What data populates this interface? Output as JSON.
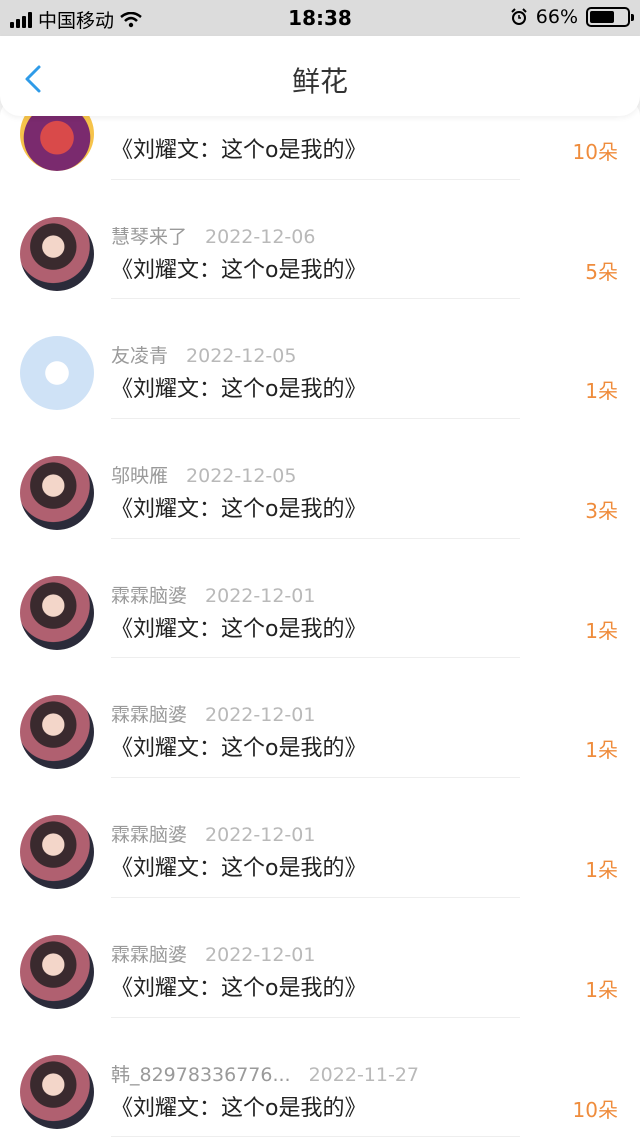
{
  "status_bar": {
    "carrier": "中国移动",
    "time": "18:38",
    "battery_pct": "66%",
    "battery_level": 0.66,
    "icons": [
      "signal-icon",
      "wifi-icon",
      "alarm-icon",
      "battery-icon"
    ]
  },
  "header": {
    "title": "鲜花",
    "back_icon": "chevron-left-icon",
    "accent": "#2f9be8"
  },
  "colors": {
    "amount": "#ef8c3c",
    "name": "#9a9a9a",
    "date": "#b9b9b9"
  },
  "gifts": [
    {
      "name": "",
      "date": "",
      "book": "《刘耀文：这个o是我的》",
      "amount": "10朵",
      "avatar": "cartoon-avatar"
    },
    {
      "name": "慧琴来了",
      "date": "2022-12-06",
      "book": "《刘耀文：这个o是我的》",
      "amount": "5朵",
      "avatar": "photo-avatar"
    },
    {
      "name": "友凌青",
      "date": "2022-12-05",
      "book": "《刘耀文：这个o是我的》",
      "amount": "1朵",
      "avatar": "default-avatar"
    },
    {
      "name": "邬映雁",
      "date": "2022-12-05",
      "book": "《刘耀文：这个o是我的》",
      "amount": "3朵",
      "avatar": "photo-avatar"
    },
    {
      "name": "霖霖脑婆",
      "date": "2022-12-01",
      "book": "《刘耀文：这个o是我的》",
      "amount": "1朵",
      "avatar": "photo-avatar"
    },
    {
      "name": "霖霖脑婆",
      "date": "2022-12-01",
      "book": "《刘耀文：这个o是我的》",
      "amount": "1朵",
      "avatar": "photo-avatar"
    },
    {
      "name": "霖霖脑婆",
      "date": "2022-12-01",
      "book": "《刘耀文：这个o是我的》",
      "amount": "1朵",
      "avatar": "photo-avatar"
    },
    {
      "name": "霖霖脑婆",
      "date": "2022-12-01",
      "book": "《刘耀文：这个o是我的》",
      "amount": "1朵",
      "avatar": "photo-avatar"
    },
    {
      "name": "韩_82978336776...",
      "date": "2022-11-27",
      "book": "《刘耀文：这个o是我的》",
      "amount": "10朵",
      "avatar": "photo-avatar"
    }
  ]
}
